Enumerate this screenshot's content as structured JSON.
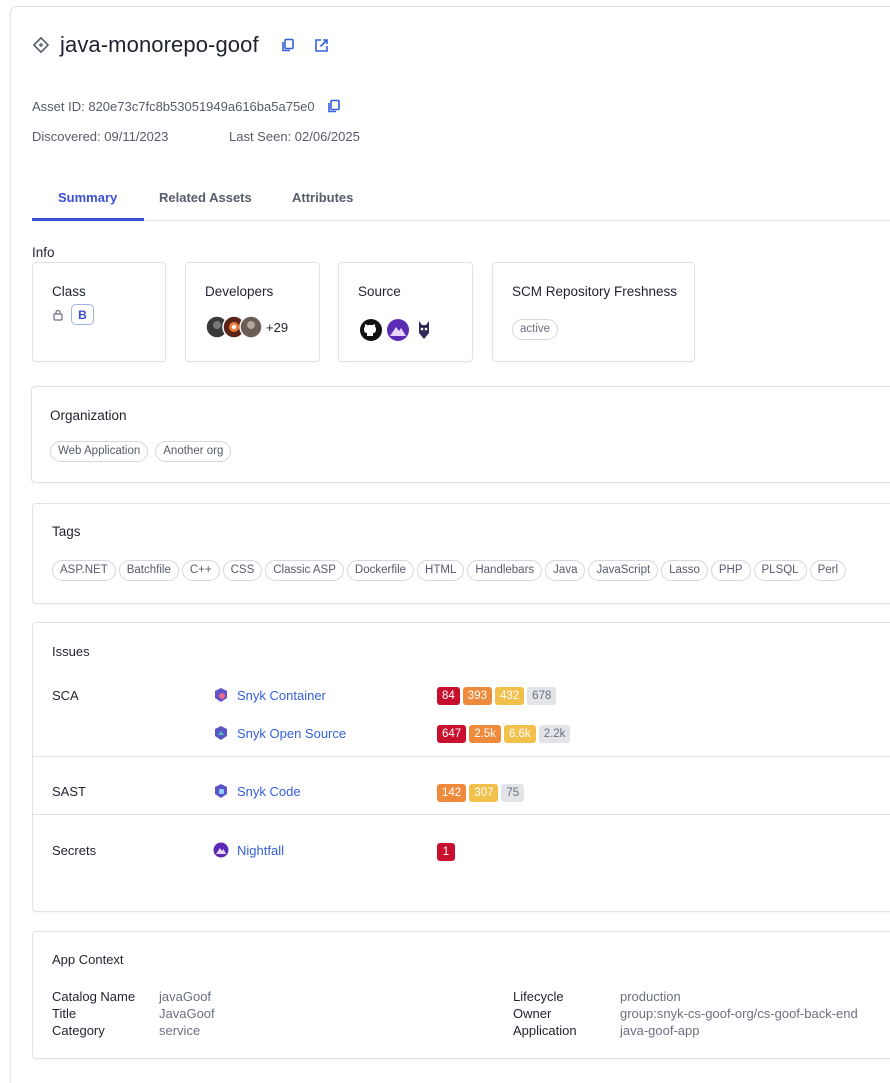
{
  "header": {
    "title": "java-monorepo-goof",
    "asset_id": "Asset ID: 820e73c7fc8b53051949a616ba5a75e0",
    "discovered": "Discovered: 09/11/2023",
    "last_seen": "Last Seen: 02/06/2025"
  },
  "tabs": [
    {
      "label": "Summary",
      "active": true
    },
    {
      "label": "Related Assets",
      "active": false
    },
    {
      "label": "Attributes",
      "active": false
    }
  ],
  "info": {
    "heading": "Info",
    "class_label": "Class",
    "class_value": "B",
    "developers_label": "Developers",
    "developers_more": "+29",
    "source_label": "Source",
    "freshness_label": "SCM Repository Freshness",
    "freshness_value": "active"
  },
  "organization": {
    "label": "Organization",
    "items": [
      "Web Application",
      "Another org"
    ]
  },
  "tags": {
    "label": "Tags",
    "items": [
      "ASP.NET",
      "Batchfile",
      "C++",
      "CSS",
      "Classic ASP",
      "Dockerfile",
      "HTML",
      "Handlebars",
      "Java",
      "JavaScript",
      "Lasso",
      "PHP",
      "PLSQL",
      "Perl"
    ]
  },
  "issues": {
    "label": "Issues",
    "groups": [
      {
        "name": "SCA",
        "rows": [
          {
            "tool": "Snyk Container",
            "counts": [
              "84",
              "393",
              "432",
              "678"
            ]
          },
          {
            "tool": "Snyk Open Source",
            "counts": [
              "647",
              "2.5k",
              "6.6k",
              "2.2k"
            ]
          }
        ]
      },
      {
        "name": "SAST",
        "rows": [
          {
            "tool": "Snyk Code",
            "counts": [
              "142",
              "307",
              "75"
            ]
          }
        ]
      },
      {
        "name": "Secrets",
        "rows": [
          {
            "tool": "Nightfall",
            "counts": [
              "1"
            ]
          }
        ]
      }
    ],
    "colors": {
      "critical": "#c8102e",
      "high": "#ee8a3c",
      "medium": "#f2c14b",
      "low": "#e3e4e8"
    }
  },
  "app_context": {
    "label": "App Context",
    "left": [
      {
        "k": "Catalog Name",
        "v": "javaGoof"
      },
      {
        "k": "Title",
        "v": "JavaGoof"
      },
      {
        "k": "Category",
        "v": "service"
      }
    ],
    "right": [
      {
        "k": "Lifecycle",
        "v": "production"
      },
      {
        "k": "Owner",
        "v": "group:snyk-cs-goof-org/cs-goof-back-end"
      },
      {
        "k": "Application",
        "v": "java-goof-app"
      }
    ]
  },
  "icons": [
    "repo-diamond-icon",
    "copy-icon",
    "external-link-icon",
    "lock-icon",
    "github-icon",
    "nightfall-icon",
    "snyk-icon"
  ]
}
